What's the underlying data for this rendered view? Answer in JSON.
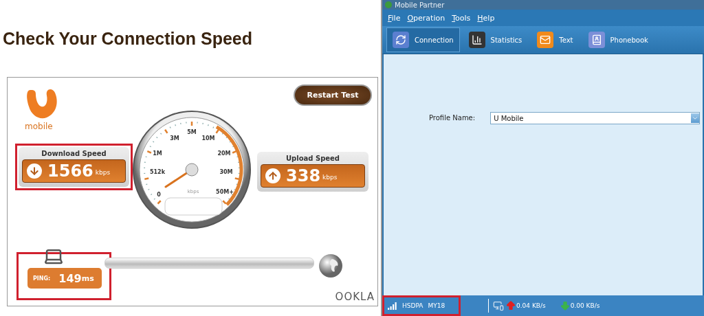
{
  "heading": "Check Your Connection Speed",
  "speedtest": {
    "brand": "mobile",
    "restart_button": "Restart Test",
    "download": {
      "label": "Download Speed",
      "value": "1566",
      "unit": "kbps",
      "highlighted": true
    },
    "upload": {
      "label": "Upload Speed",
      "value": "338",
      "unit": "kbps",
      "highlighted": false
    },
    "gauge": {
      "scale_labels": [
        "5M",
        "3M",
        "10M",
        "1M",
        "20M",
        "512k",
        "30M",
        "0",
        "50M+"
      ],
      "unit": "kbps"
    },
    "ping": {
      "label": "PING:",
      "value": "149",
      "unit": "ms",
      "highlighted": true
    },
    "footer_logo": "OOKLA"
  },
  "app": {
    "window": {
      "title": "Mobile Partner"
    },
    "menu": [
      "File",
      "Operation",
      "Tools",
      "Help"
    ],
    "tabs": [
      {
        "label": "Connection",
        "selected": true,
        "kind": "connection"
      },
      {
        "label": "Statistics",
        "selected": false,
        "kind": "statistics"
      },
      {
        "label": "Text",
        "selected": false,
        "kind": "text"
      },
      {
        "label": "Phonebook",
        "selected": false,
        "kind": "phonebook"
      }
    ],
    "profile": {
      "label": "Profile Name:",
      "value": "U Mobile"
    },
    "status_bar": {
      "network": {
        "type": "HSDPA",
        "operator": "MY18",
        "highlighted": true
      },
      "upload_rate": "0.04 KB/s",
      "download_rate": "0.00 KB/s"
    }
  }
}
